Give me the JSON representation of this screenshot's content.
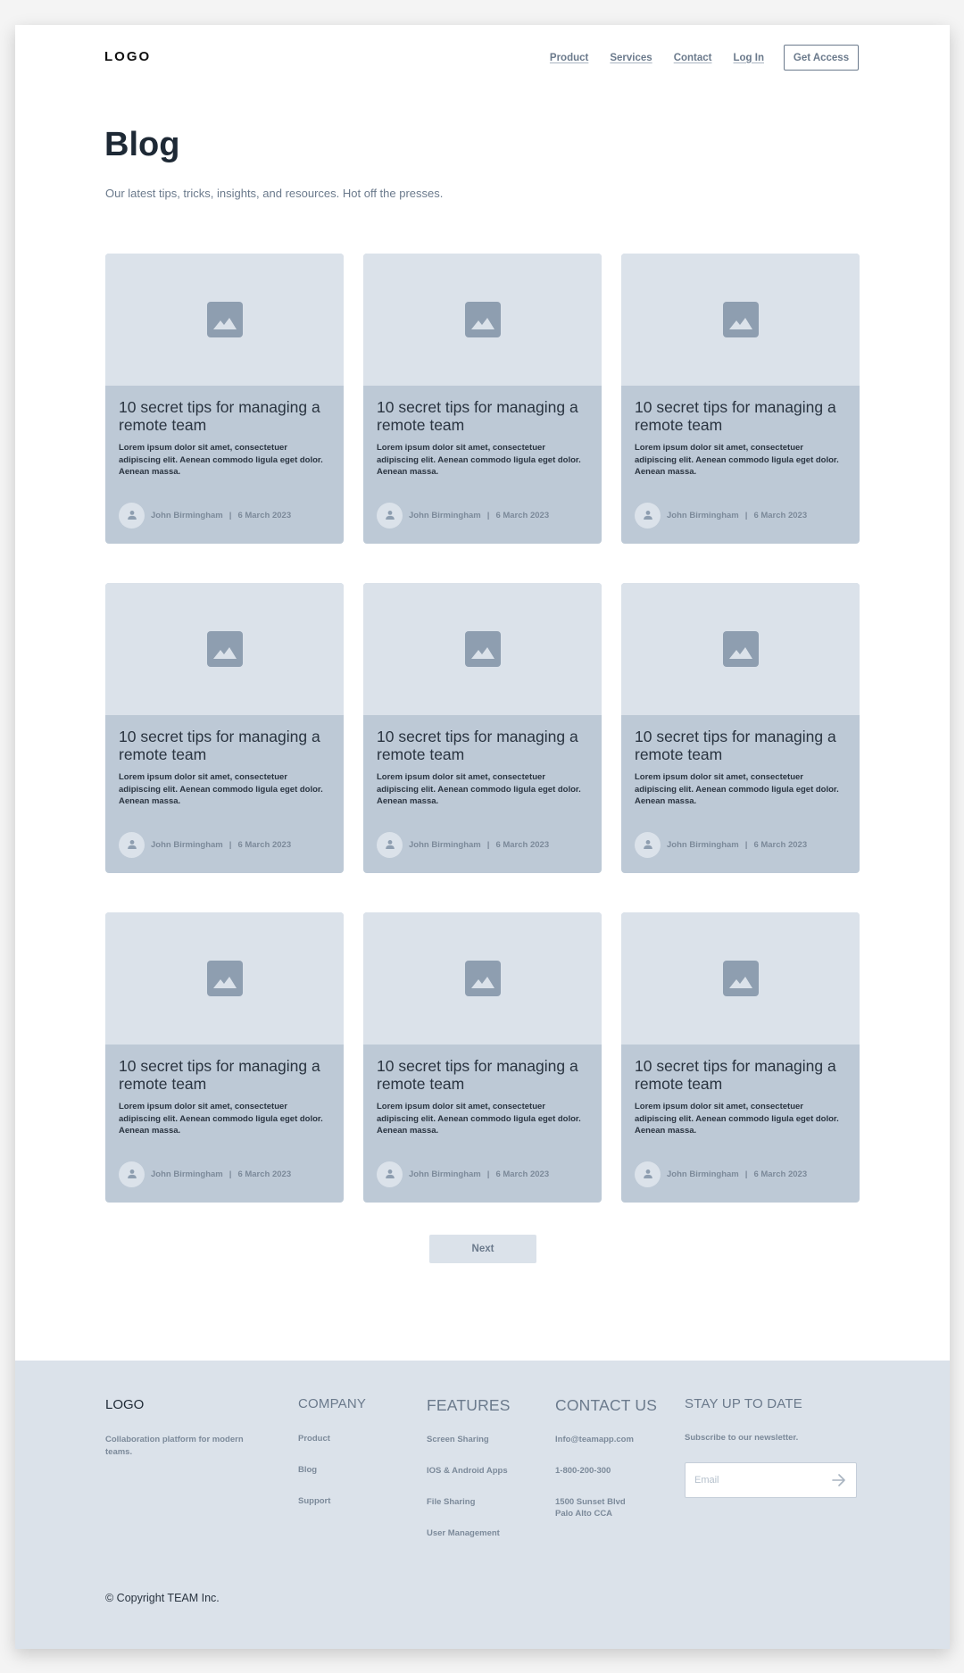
{
  "header": {
    "logo": "LOGO",
    "nav": [
      {
        "label": "Product"
      },
      {
        "label": "Services"
      },
      {
        "label": "Contact"
      },
      {
        "label": "Log In"
      }
    ],
    "cta_label": "Get Access"
  },
  "hero": {
    "title": "Blog",
    "subtitle": "Our latest tips, tricks, insights, and resources. Hot off the presses."
  },
  "posts": [
    {
      "title": "10 secret tips for managing a remote team",
      "excerpt": "Lorem ipsum dolor sit amet, consectetuer adipiscing elit. Aenean commodo ligula eget dolor. Aenean massa.",
      "author": "John Birmingham",
      "date": "6 March 2023",
      "image_icon": "image-placeholder-icon",
      "avatar_icon": "user-icon"
    },
    {
      "title": "10 secret tips for managing a remote team",
      "excerpt": "Lorem ipsum dolor sit amet, consectetuer adipiscing elit. Aenean commodo ligula eget dolor. Aenean massa.",
      "author": "John Birmingham",
      "date": "6 March 2023",
      "image_icon": "image-placeholder-icon",
      "avatar_icon": "user-icon"
    },
    {
      "title": "10 secret tips for managing a remote team",
      "excerpt": "Lorem ipsum dolor sit amet, consectetuer adipiscing elit. Aenean commodo ligula eget dolor. Aenean massa.",
      "author": "John Birmingham",
      "date": "6 March 2023",
      "image_icon": "image-placeholder-icon",
      "avatar_icon": "user-icon"
    },
    {
      "title": "10 secret tips for managing a remote team",
      "excerpt": "Lorem ipsum dolor sit amet, consectetuer adipiscing elit. Aenean commodo ligula eget dolor. Aenean massa.",
      "author": "John Birmingham",
      "date": "6 March 2023",
      "image_icon": "image-placeholder-icon",
      "avatar_icon": "user-icon"
    },
    {
      "title": "10 secret tips for managing a remote team",
      "excerpt": "Lorem ipsum dolor sit amet, consectetuer adipiscing elit. Aenean commodo ligula eget dolor. Aenean massa.",
      "author": "John Birmingham",
      "date": "6 March 2023",
      "image_icon": "image-placeholder-icon",
      "avatar_icon": "user-icon"
    },
    {
      "title": "10 secret tips for managing a remote team",
      "excerpt": "Lorem ipsum dolor sit amet, consectetuer adipiscing elit. Aenean commodo ligula eget dolor. Aenean massa.",
      "author": "John Birmingham",
      "date": "6 March 2023",
      "image_icon": "image-placeholder-icon",
      "avatar_icon": "user-icon"
    },
    {
      "title": "10 secret tips for managing a remote team",
      "excerpt": "Lorem ipsum dolor sit amet, consectetuer adipiscing elit. Aenean commodo ligula eget dolor. Aenean massa.",
      "author": "John Birmingham",
      "date": "6 March 2023",
      "image_icon": "image-placeholder-icon",
      "avatar_icon": "user-icon"
    },
    {
      "title": "10 secret tips for managing a remote team",
      "excerpt": "Lorem ipsum dolor sit amet, consectetuer adipiscing elit. Aenean commodo ligula eget dolor. Aenean massa.",
      "author": "John Birmingham",
      "date": "6 March 2023",
      "image_icon": "image-placeholder-icon",
      "avatar_icon": "user-icon"
    },
    {
      "title": "10 secret tips for managing a remote team",
      "excerpt": "Lorem ipsum dolor sit amet, consectetuer adipiscing elit. Aenean commodo ligula eget dolor. Aenean massa.",
      "author": "John Birmingham",
      "date": "6 March 2023",
      "image_icon": "image-placeholder-icon",
      "avatar_icon": "user-icon"
    }
  ],
  "meta_separator": "|",
  "pagination": {
    "next_label": "Next"
  },
  "footer": {
    "logo": "LOGO",
    "description": "Collaboration platform for modern teams.",
    "company": {
      "heading": "COMPANY",
      "links": [
        "Product",
        "Blog",
        "Support"
      ]
    },
    "features": {
      "heading": "FEATURES",
      "links": [
        "Screen Sharing",
        "IOS & Android Apps",
        "File Sharing",
        "User Management"
      ]
    },
    "contact": {
      "heading": "CONTACT US",
      "email": "Info@teamapp.com",
      "phone": "1-800-200-300",
      "address_line1": "1500 Sunset Blvd",
      "address_line2": "Palo Alto CCA"
    },
    "newsletter": {
      "heading": "STAY UP TO DATE",
      "text": "Subscribe to our newsletter.",
      "email_placeholder": "Email",
      "email_value": "",
      "submit_icon": "arrow-right-icon"
    },
    "copyright": "© Copyright TEAM Inc."
  },
  "colors": {
    "page_bg": "#ffffff",
    "card_image_bg": "#dbe2ea",
    "card_body_bg": "#bdc9d6",
    "footer_bg": "#dbe2ea",
    "text_dark": "#1e2935",
    "text_muted": "#6b7a8c",
    "icon_fill": "#8e9eb0"
  }
}
